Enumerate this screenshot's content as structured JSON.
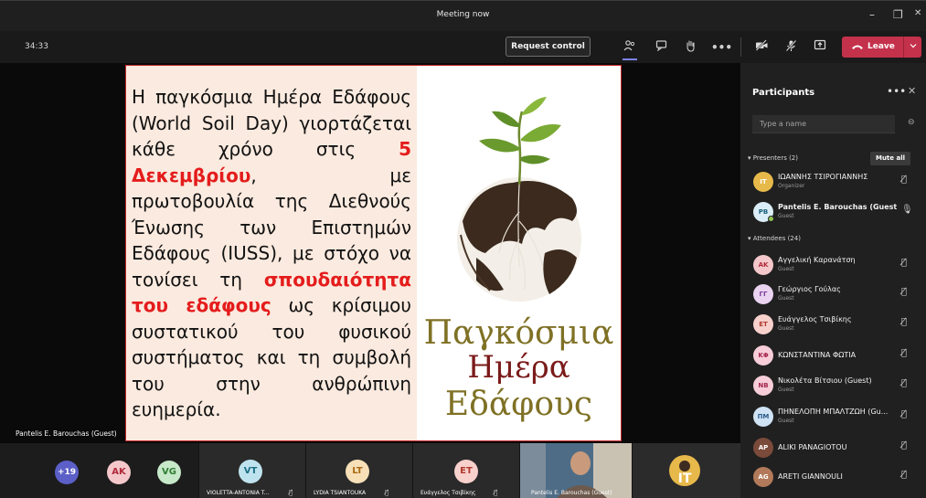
{
  "window": {
    "title": "Meeting now",
    "controls": [
      "–",
      "❐",
      "✕"
    ]
  },
  "toolbar": {
    "timer": "34:33",
    "request_control": "Request control",
    "leave": "Leave",
    "icons": [
      "people-icon",
      "chat-icon",
      "raise-hand-icon",
      "more-icon",
      "camera-off-icon",
      "mic-off-icon",
      "share-icon"
    ]
  },
  "slide": {
    "lines": [
      "Η παγκόσμια Ημέρα Εδάφους (World Soil Day) γιορτάζεται κάθε χρόνο στις ",
      "5 Δεκεμβρίου",
      ", με πρωτοβουλία της Διεθνούς Ένωσης των Επιστημών Εδάφους (IUSS), με στόχο να τονίσει τη ",
      "σπουδαιότητα του εδάφους",
      " ως κρίσιμου συστατικού του φυσικού συστήματος και τη συμβολή του στην ανθρώπινη ευημερία."
    ],
    "title_line1": "Παγκόσμια",
    "title_line2": "Ημέρα",
    "title_line3": "Εδάφους",
    "presenter_label": "Pantelis E. Barouchas (Guest)"
  },
  "strip": {
    "overflow": "+19",
    "tiles": [
      {
        "initials": "AK",
        "color": "#f4c8cb",
        "text_color": "#b02a3a"
      },
      {
        "initials": "VG",
        "color": "#c7e8c9",
        "text_color": "#2e7d32"
      },
      {
        "initials": "VT",
        "name": "VIOLETTA-ANTONIA T...",
        "color": "#bfe3ee",
        "text_color": "#1a6f85"
      },
      {
        "initials": "LT",
        "name": "LYDIA TSIANTOUKA",
        "color": "#f7e0b8",
        "text_color": "#a76a12"
      },
      {
        "initials": "ET",
        "name": "Ευάγγελος Τσιβίκης",
        "color": "#f8d0cc",
        "text_color": "#b03a2e"
      },
      {
        "name": "Pantelis E. Barouchas (Guest)"
      }
    ]
  },
  "participants": {
    "title": "Participants",
    "search_placeholder": "Type a name",
    "presenters_label": "Presenters (2)",
    "mute_all": "Mute all",
    "attendees_label": "Attendees (24)",
    "presenters": [
      {
        "initials": "IT",
        "name": "ΙΩΑΝΝΗΣ ΤΣΙΡΟΓΙΑΝΝΗΣ",
        "sub": "Organizer",
        "color": "#e7b94a",
        "text_color": "#fff"
      },
      {
        "initials": "PB",
        "name": "Pantelis E. Barouchas (Guest)",
        "sub": "Guest",
        "color": "#dbeef7",
        "text_color": "#1a5f7a"
      }
    ],
    "attendees": [
      {
        "initials": "AK",
        "name": "Αγγελική Καρανάτση",
        "sub": "Guest",
        "color": "#f4c8cb",
        "text_color": "#b02a3a"
      },
      {
        "initials": "ΓΓ",
        "name": "Γεώργιος Γούλας",
        "sub": "Guest",
        "color": "#e9d3f1",
        "text_color": "#7a3a93"
      },
      {
        "initials": "ΕΤ",
        "name": "Ευάγγελος Τσιβίκης",
        "sub": "Guest",
        "color": "#f8d0cc",
        "text_color": "#b03a2e"
      },
      {
        "initials": "ΚΦ",
        "name": "ΚΩΝΣΤΑΝΤΙΝΑ ΦΩΤΙΑ",
        "sub": "",
        "color": "#f6cdd9",
        "text_color": "#a52750"
      },
      {
        "initials": "ΝΒ",
        "name": "Νικολέτα Βίτσιου (Guest)",
        "sub": "Guest",
        "color": "#f6cdd9",
        "text_color": "#a52750"
      },
      {
        "initials": "ΠΜ",
        "name": "ΠΗΝΕΛΟΠΗ ΜΠΑΛΤΖΩΗ (Gu...",
        "sub": "Guest",
        "color": "#cfe3f5",
        "text_color": "#2a5a8a"
      },
      {
        "initials": "AP",
        "name": "ALIKI PANAGIOTOU",
        "sub": "",
        "color": "#7a4a3a",
        "text_color": "#fff"
      },
      {
        "initials": "AG",
        "name": "ARETI GIANNOULI",
        "sub": "",
        "color": "#b27a5a",
        "text_color": "#fff"
      }
    ]
  }
}
